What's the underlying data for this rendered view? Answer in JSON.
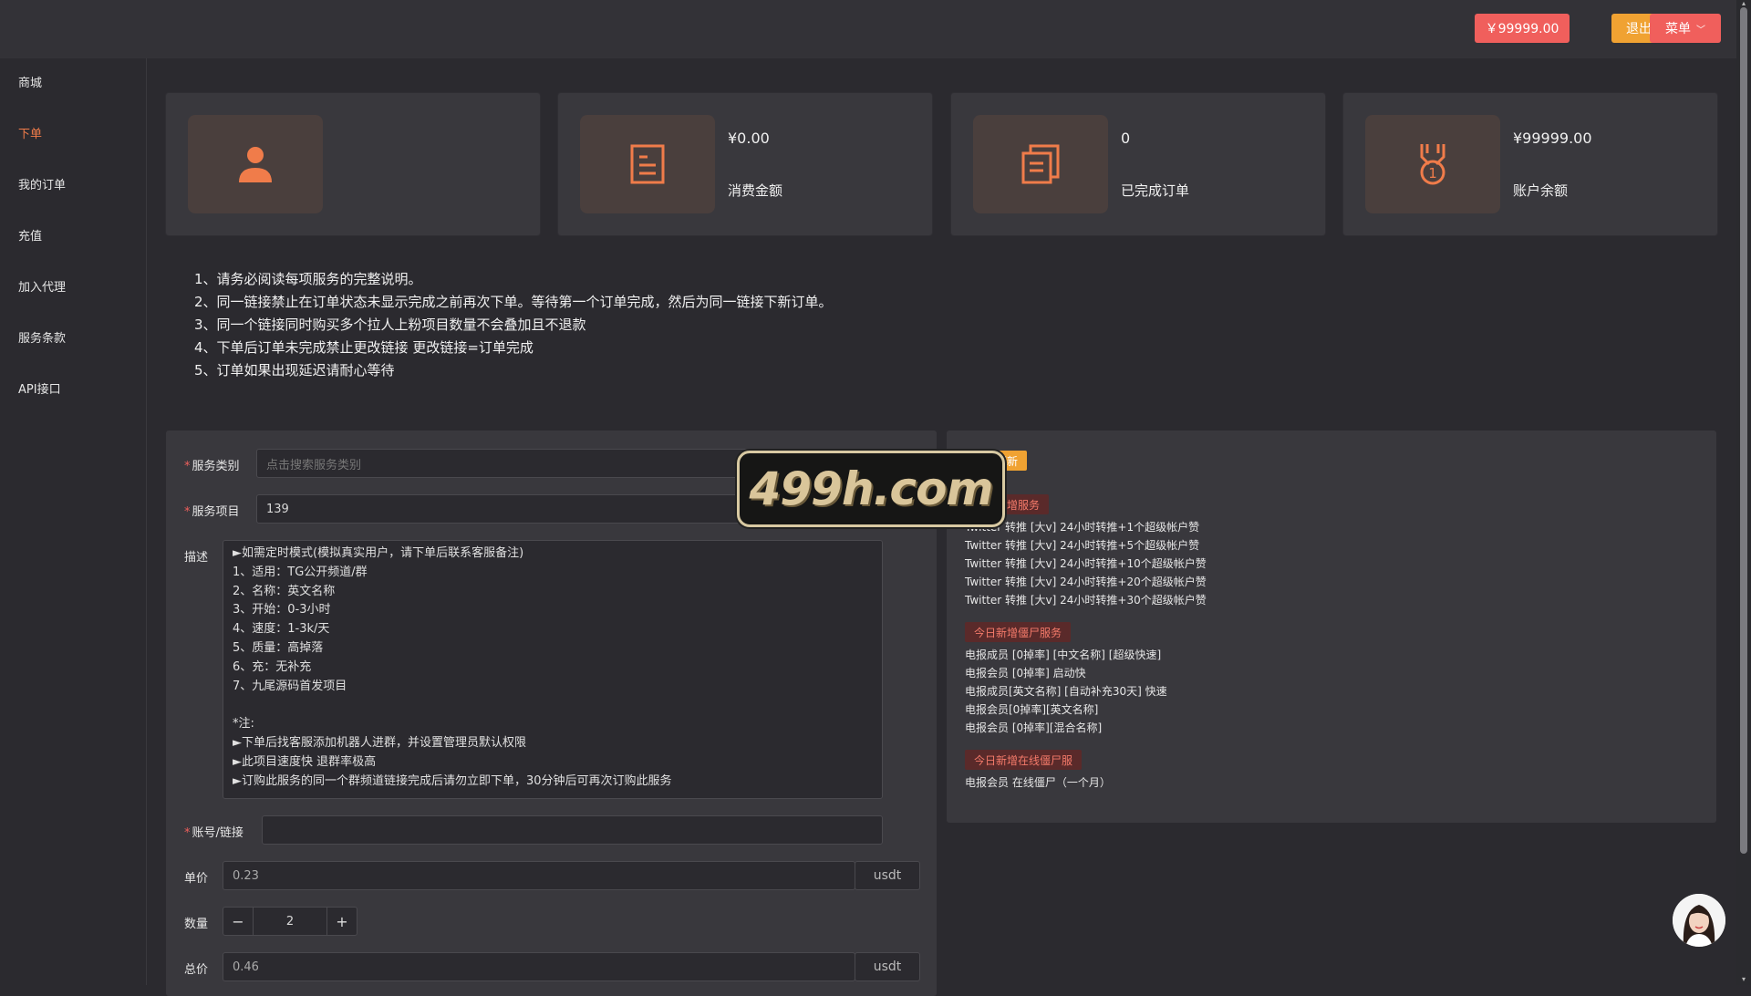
{
  "header": {
    "balance_button": "￥99999.00",
    "logout_button": "退出",
    "menu_button": "菜单"
  },
  "sidebar": {
    "items": [
      {
        "label": "商城"
      },
      {
        "label": "下单"
      },
      {
        "label": "我的订单"
      },
      {
        "label": "充值"
      },
      {
        "label": "加入代理"
      },
      {
        "label": "服务条款"
      },
      {
        "label": "API接口"
      }
    ],
    "active_index": 1
  },
  "stats": [
    {
      "icon": "user-icon",
      "value": "",
      "label": ""
    },
    {
      "icon": "document-icon",
      "value": "¥0.00",
      "label": "消费金额"
    },
    {
      "icon": "copy-document-icon",
      "value": "0",
      "label": "已完成订单"
    },
    {
      "icon": "medal-icon",
      "value": "¥99999.00",
      "label": "账户余额"
    }
  ],
  "notice": [
    "1、请务必阅读每项服务的完整说明。",
    "2、同一链接禁止在订单状态未显示完成之前再次下单。等待第一个订单完成，然后为同一链接下新订单。",
    "3、同一个链接同时购买多个拉人上粉项目数量不会叠加且不退款",
    "4、下单后订单未完成禁止更改链接 更改链接=订单完成",
    "5、订单如果出现延迟请耐心等待"
  ],
  "form": {
    "category_label": "服务类别",
    "category_placeholder": "点击搜索服务类别",
    "item_label": "服务项目",
    "item_value": "139",
    "desc_label": "描述",
    "desc_lines": [
      "►如需定时模式(模拟真实用户，请下单后联系客服备注)",
      "1、适用：TG公开频道/群",
      "2、名称：英文名称",
      "3、开始：0-3小时",
      "4、速度：1-3k/天",
      "5、质量：高掉落",
      "6、充：无补充",
      "7、九尾源码首发项目",
      "",
      "*注:",
      "►下单后找客服添加机器人进群，并设置管理员默认权限",
      "►此项目速度快 退群率极高",
      "►订购此服务的同一个群频道链接完成后请勿立即下单，30分钟后可再次订购此服务"
    ],
    "account_label": "账号/链接",
    "account_value": "",
    "unit_price_label": "单价",
    "unit_price_value": "0.23",
    "unit_price_suffix": "usdt",
    "quantity_label": "数量",
    "quantity_value": "2",
    "minus": "−",
    "plus": "+",
    "total_label": "总价",
    "total_value": "0.46",
    "total_suffix": "usdt"
  },
  "right_panel": {
    "realtime_tag": "实时更新",
    "group1_tag": "今日新增服务",
    "group1_items": [
      "Twitter 转推 [大v] 24小时转推+1个超级帐户赞",
      "Twitter 转推 [大v] 24小时转推+5个超级帐户赞",
      "Twitter 转推 [大v] 24小时转推+10个超级帐户赞",
      "Twitter 转推 [大v] 24小时转推+20个超级帐户赞",
      "Twitter 转推 [大v] 24小时转推+30个超级帐户赞"
    ],
    "group2_tag": "今日新增僵尸服务",
    "group2_items": [
      "电报成员 [0掉率] [中文名称] [超级快速]",
      "电报会员 [0掉率] 启动快",
      "电报成员[英文名称] [自动补充30天] 快速",
      "电报会员[0掉率][英文名称]",
      "电报会员 [0掉率][混合名称]"
    ],
    "group3_tag": "今日新增在线僵尸服",
    "group3_items": [
      "电报会员 在线僵尸（一个月）"
    ]
  },
  "watermark": "499h.com",
  "colors": {
    "accent_red": "#f05f5c",
    "accent_orange": "#f0a232",
    "active_nav": "#f07c4a",
    "icon_orange": "#f07c4a"
  }
}
